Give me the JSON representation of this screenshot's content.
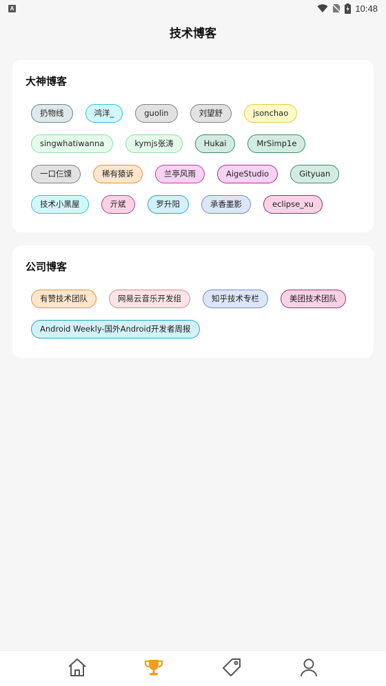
{
  "status_bar": {
    "time": "10:48",
    "left_icon_letter": "A"
  },
  "page_title": "技术博客",
  "sections": [
    {
      "title": "大神博客",
      "tags": [
        {
          "label": "扔物线",
          "bg": "#dfe8ea",
          "border": "#5e8890"
        },
        {
          "label": "鸿洋_",
          "bg": "#d2f7fa",
          "border": "#38c3d0"
        },
        {
          "label": "guolin",
          "bg": "#e2e2e2",
          "border": "#808080"
        },
        {
          "label": "刘望舒",
          "bg": "#e2e2e2",
          "border": "#808080"
        },
        {
          "label": "jsonchao",
          "bg": "#fff8c8",
          "border": "#e6cf3c"
        },
        {
          "label": "singwhatiwanna",
          "bg": "#e6fbec",
          "border": "#8fdca6"
        },
        {
          "label": "kymjs张涛",
          "bg": "#e6fbec",
          "border": "#8fdca6"
        },
        {
          "label": "Hukai",
          "bg": "#d3ece1",
          "border": "#3e8a67"
        },
        {
          "label": "MrSimp1e",
          "bg": "#d3ece1",
          "border": "#3e8a67"
        },
        {
          "label": "一口仨馍",
          "bg": "#e2e2e2",
          "border": "#808080"
        },
        {
          "label": "稀有猿诉",
          "bg": "#ffe6cc",
          "border": "#e7922e"
        },
        {
          "label": "兰亭风雨",
          "bg": "#f9d2f3",
          "border": "#c23ab0"
        },
        {
          "label": "AigeStudio",
          "bg": "#f9d2f3",
          "border": "#a82c95"
        },
        {
          "label": "Gityuan",
          "bg": "#d3ece1",
          "border": "#3e8a67"
        },
        {
          "label": "技术小黑屋",
          "bg": "#d2f7fa",
          "border": "#38c3d0"
        },
        {
          "label": "亓斌",
          "bg": "#fad2e6",
          "border": "#c23a86"
        },
        {
          "label": "罗升阳",
          "bg": "#d2f1f9",
          "border": "#2aa6c3"
        },
        {
          "label": "承香墨影",
          "bg": "#dce6f7",
          "border": "#6c8ccc"
        },
        {
          "label": "eclipse_xu",
          "bg": "#fad2e6",
          "border": "#a82c6a"
        }
      ]
    },
    {
      "title": "公司博客",
      "tags": [
        {
          "label": "有赞技术团队",
          "bg": "#ffe6cc",
          "border": "#e7922e"
        },
        {
          "label": "网易云音乐开发组",
          "bg": "#fbe4e6",
          "border": "#d98a92"
        },
        {
          "label": "知乎技术专栏",
          "bg": "#dce6f7",
          "border": "#6c8ccc"
        },
        {
          "label": "美团技术团队",
          "bg": "#fad2e6",
          "border": "#a82c6a"
        },
        {
          "label": "Android Weekly-国外Android开发者周报",
          "bg": "#d2f1f9",
          "border": "#2aa6c3"
        }
      ]
    }
  ],
  "tabbar": {
    "tabs": [
      {
        "icon": "home-icon",
        "active": false
      },
      {
        "icon": "trophy-icon",
        "active": true
      },
      {
        "icon": "tag-icon",
        "active": false
      },
      {
        "icon": "user-icon",
        "active": false
      }
    ],
    "active_color": "#f29d22",
    "inactive_color": "#555555"
  }
}
